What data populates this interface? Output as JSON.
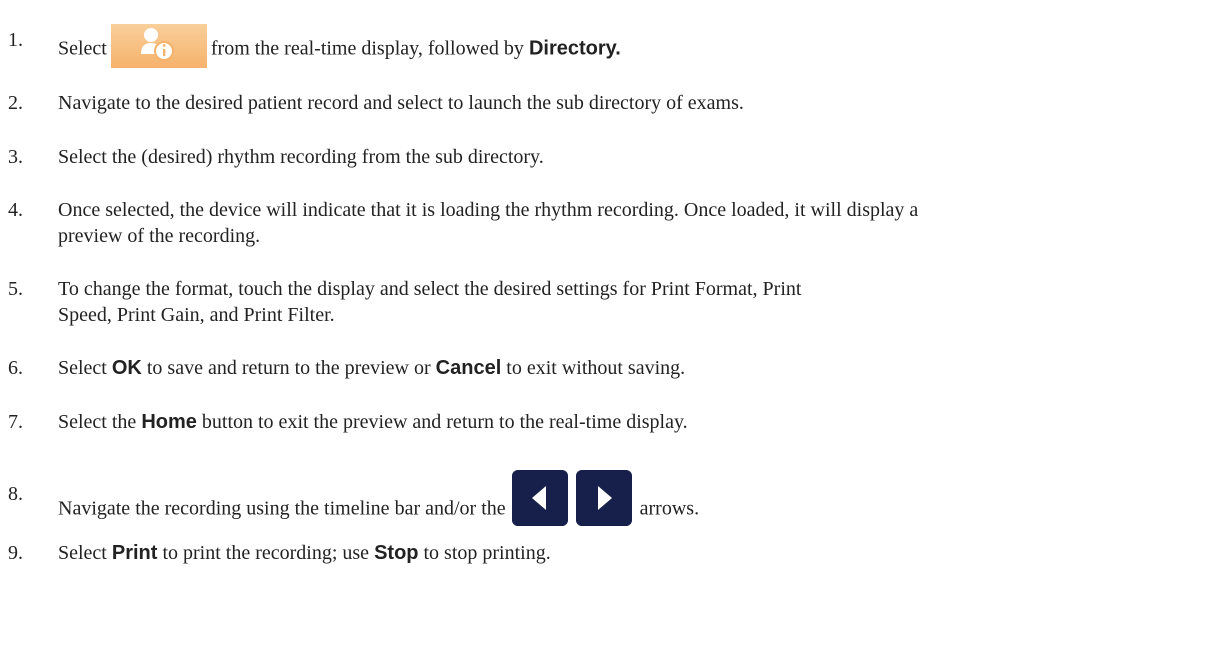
{
  "steps": [
    {
      "num": "1.",
      "a": "Select",
      "b": "from the real-time display, followed by",
      "bold": "Directory",
      "c": "."
    },
    {
      "num": "2.",
      "text": "Navigate to the desired patient record and select to launch the sub directory of exams."
    },
    {
      "num": "3.",
      "text": "Select the (desired) rhythm recording from the sub directory."
    },
    {
      "num": "4.",
      "line1": "Once selected, the device will indicate that it is loading the rhythm recording. Once loaded, it will display a",
      "line2": "preview of the recording."
    },
    {
      "num": "5.",
      "line1": "To change the format, touch the display and select the desired settings for Print Format, Print",
      "line2": "Speed, Print Gain, and Print Filter."
    },
    {
      "num": "6.",
      "a": "Select",
      "bold1": "OK",
      "b": "to save and return to the preview or",
      "bold2": "Cancel",
      "c": "to exit without saving."
    },
    {
      "num": "7.",
      "a": "Select the",
      "bold": "Home",
      "b": "button to exit the preview and return to the real-time display."
    },
    {
      "num": "8.",
      "a": "Navigate the recording using the timeline bar and/or the",
      "b": "arrows."
    },
    {
      "num": "9.",
      "a": "Select",
      "bold1": "Print",
      "b": "to print the recording; use",
      "bold2": "Stop",
      "c": "to stop printing."
    }
  ],
  "icons": {
    "settings": "patient-info-icon",
    "left": "left-arrow-icon",
    "right": "right-arrow-icon",
    "settings_color": "#f6b873",
    "arrow_color": "#17204a"
  }
}
